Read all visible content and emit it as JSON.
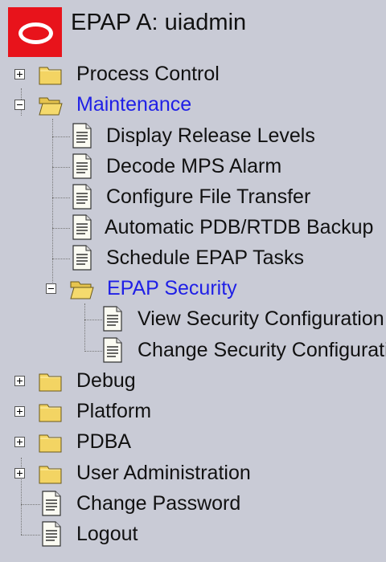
{
  "header": {
    "title": "EPAP A: uiadmin",
    "logo_color": "#e8131b"
  },
  "menu": {
    "process_control": "Process Control",
    "maintenance": "Maintenance",
    "maintenance_items": {
      "display_release_levels": "Display Release Levels",
      "decode_mps_alarm": "Decode MPS Alarm",
      "configure_file_transfer": "Configure File Transfer",
      "automatic_backup": "Automatic PDB/RTDB Backup",
      "schedule_epap_tasks": "Schedule EPAP Tasks"
    },
    "epap_security": "EPAP Security",
    "security_items": {
      "view_security_configuration": "View Security Configuration",
      "change_security_configuration": "Change Security Configuration"
    },
    "debug": "Debug",
    "platform": "Platform",
    "pdba": "PDBA",
    "user_administration": "User Administration",
    "change_password": "Change Password",
    "logout": "Logout"
  },
  "colors": {
    "background": "#c9cbd6",
    "link": "#1f1fe6",
    "folder": "#f3d463"
  }
}
